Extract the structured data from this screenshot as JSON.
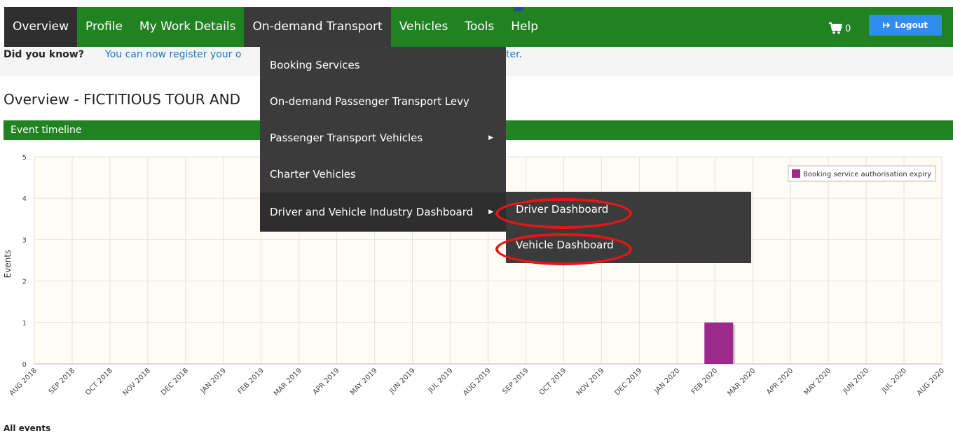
{
  "nav": {
    "items": [
      "Overview",
      "Profile",
      "My Work Details",
      "On-demand Transport",
      "Vehicles",
      "Tools",
      "Help"
    ],
    "cart_count": "0",
    "logout_label": "Logout"
  },
  "notice": {
    "label": "Did you know?",
    "text_start": "You can now register your o",
    "text_end": "ter."
  },
  "page": {
    "title": "Overview - FICTITIOUS TOUR AND",
    "timeline_header": "Event timeline",
    "all_events_label": "All events"
  },
  "dropdown": {
    "items": [
      "Booking Services",
      "On-demand Passenger Transport Levy",
      "Passenger Transport Vehicles",
      "Charter Vehicles",
      "Driver and Vehicle Industry Dashboard"
    ],
    "submenu": [
      "Driver Dashboard",
      "Vehicle Dashboard"
    ]
  },
  "colors": {
    "nav_green": "#218221",
    "menu_dark": "#3b3b3b",
    "bar": "#9b2a8c",
    "highlight_circle": "#e51616",
    "logout_blue": "#2f8df0"
  },
  "chart_data": {
    "type": "bar",
    "ylabel": "Events",
    "ylim": [
      0,
      5
    ],
    "yticks": [
      "0",
      "1",
      "2",
      "3",
      "4",
      "5"
    ],
    "categories": [
      "AUG 2018",
      "SEP 2018",
      "OCT 2018",
      "NOV 2018",
      "DEC 2018",
      "JAN 2019",
      "FEB 2019",
      "MAR 2019",
      "APR 2019",
      "MAY 2019",
      "JUN 2019",
      "JUL 2019",
      "AUG 2019",
      "SEP 2019",
      "OCT 2019",
      "NOV 2019",
      "DEC 2019",
      "JAN 2020",
      "FEB 2020",
      "MAR 2020",
      "APR 2020",
      "MAY 2020",
      "JUN 2020",
      "JUL 2020",
      "AUG 2020"
    ],
    "series": [
      {
        "name": "Booking service authorisation expiry",
        "values": [
          0,
          0,
          0,
          0,
          0,
          0,
          0,
          0,
          0,
          0,
          0,
          0,
          0,
          0,
          0,
          0,
          0,
          0,
          1,
          0,
          0,
          0,
          0,
          0,
          0
        ]
      }
    ],
    "grid": true,
    "legend": "top-right"
  }
}
